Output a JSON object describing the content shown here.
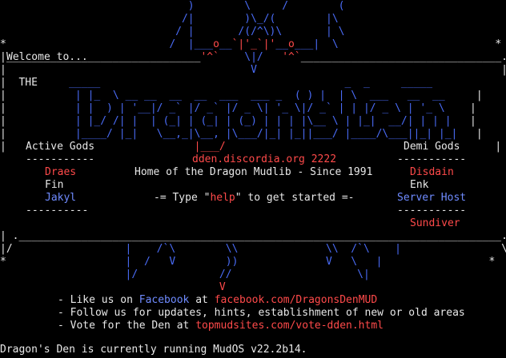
{
  "terminal": {
    "welcome": "Welcome to...",
    "the": "THE",
    "active_gods_title": "Active Gods",
    "active_gods": [
      "Draes",
      "Fin",
      "Jakyl"
    ],
    "demi_gods_title": "Demi Gods",
    "demi_gods": [
      "Disdain",
      "Enk",
      "Server Host",
      "Sundiver"
    ],
    "address_host": "dden.discordia.org",
    "address_port": "2222",
    "tagline": "Home of the Dragon Mudlib - Since 1991",
    "help_prefix": "-= Type \"",
    "help_word": "help",
    "help_suffix": "\" to get started =-",
    "bullets": [
      {
        "prefix": "- Like us on ",
        "link1": "Facebook",
        "mid": " at ",
        "link2": "facebook.com/DragonsDenMUD"
      },
      {
        "text": "- Follow us for updates, hints, establishment of new or old areas"
      },
      {
        "prefix": "- Vote for the Den at ",
        "link2": "topmudsites.com/vote-dden.html"
      }
    ],
    "status_line": "Dragon's Den is currently running MudOS v22.2b14."
  },
  "colors": {
    "background": "#000000",
    "text": "#e8e8e8",
    "blue": "#4a6cf7",
    "red": "#ff4a4a"
  }
}
